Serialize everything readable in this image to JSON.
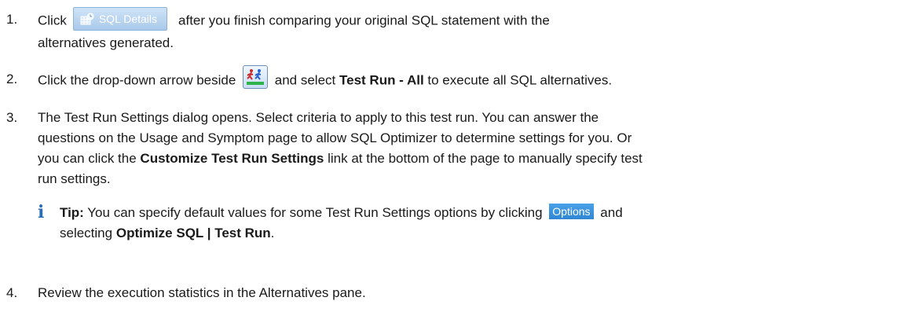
{
  "steps": [
    {
      "num": "1.",
      "before": "Click",
      "button_label": "SQL Details",
      "after_line1": "after you finish comparing your original SQL statement with the",
      "after_line2": "alternatives generated."
    },
    {
      "num": "2.",
      "before": "Click the drop-down arrow beside",
      "middle": "and select",
      "bold": "Test Run - All",
      "after": "to execute all SQL alternatives."
    },
    {
      "num": "3.",
      "line1": "The Test Run Settings dialog opens. Select criteria to apply to this test run. You can answer the",
      "line2": "questions on the Usage and Symptom page to allow SQL Optimizer to determine settings for you. Or",
      "line3_before": "you can click the",
      "line3_bold": "Customize Test Run Settings",
      "line3_after": "link at the bottom of the page to manually specify test",
      "line4": "run settings."
    },
    {
      "num": "4.",
      "text": "Review the execution statistics in the Alternatives pane."
    }
  ],
  "tip": {
    "label": "Tip:",
    "before": "You can specify default values for some Test Run Settings options by clicking",
    "button_label": "Options",
    "after": "and",
    "line2_before": "selecting",
    "line2_bold": "Optimize SQL | Test Run",
    "line2_after": "."
  },
  "icons": [
    "grid-icon",
    "test-run-icon",
    "info-icon"
  ],
  "colors": {
    "sql_button": "#a9c9ea",
    "options_button": "#2f86d3",
    "info_icon": "#2a6fb3"
  }
}
